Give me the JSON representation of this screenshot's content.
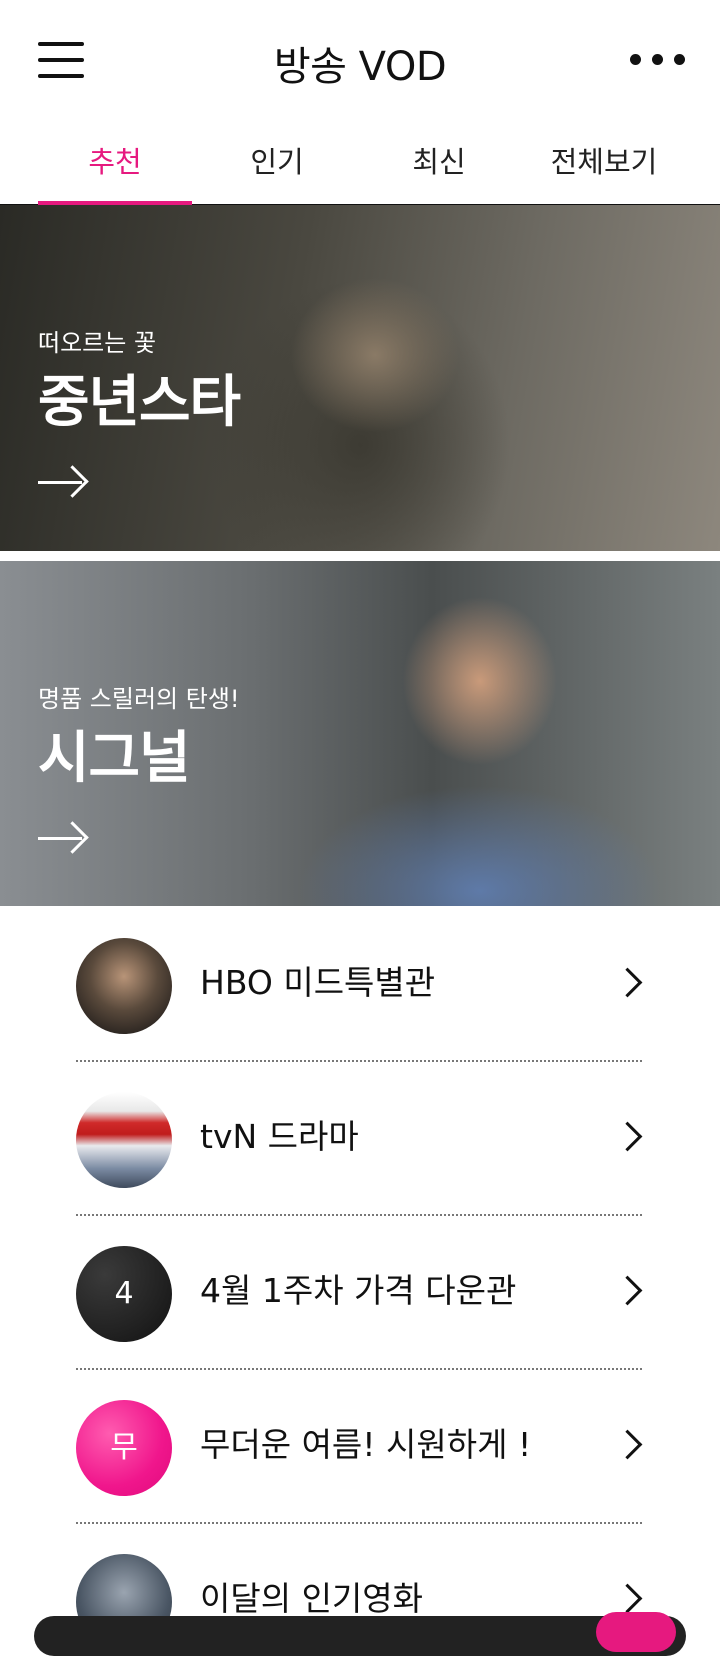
{
  "header": {
    "title": "방송 VOD",
    "menu_icon": "hamburger-menu-icon",
    "more_icon": "more-dots-icon"
  },
  "tabs": [
    {
      "label": "추천",
      "active": true
    },
    {
      "label": "인기",
      "active": false
    },
    {
      "label": "최신",
      "active": false
    },
    {
      "label": "전체보기",
      "active": false
    }
  ],
  "banners": [
    {
      "subtitle": "떠오르는 꽃",
      "title": "중년스타",
      "icon": "arrow-right-icon"
    },
    {
      "subtitle": "명품 스릴러의 탄생!",
      "title": "시그널",
      "icon": "arrow-right-icon"
    }
  ],
  "list": [
    {
      "label": "HBO 미드특별관",
      "thumb_text": "",
      "icon": "chevron-right-icon"
    },
    {
      "label": "tvN 드라마",
      "thumb_text": "",
      "icon": "chevron-right-icon"
    },
    {
      "label": "4월 1주차 가격 다운관",
      "thumb_text": "4",
      "icon": "chevron-right-icon"
    },
    {
      "label": "무더운 여름!  시원하게 !",
      "thumb_text": "무",
      "icon": "chevron-right-icon"
    },
    {
      "label": "이달의 인기영화",
      "thumb_text": "",
      "icon": "chevron-right-icon"
    }
  ],
  "colors": {
    "accent": "#e6197f",
    "text": "#111111",
    "background": "#ffffff"
  }
}
